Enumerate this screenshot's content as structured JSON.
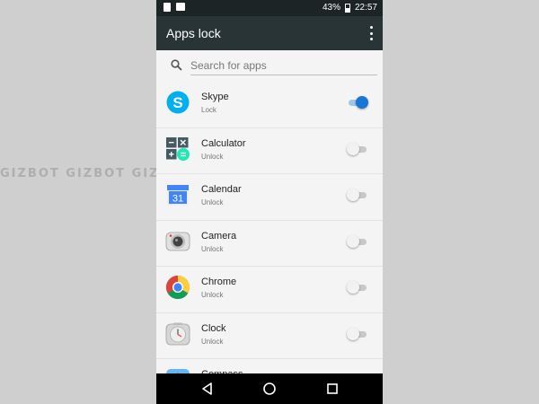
{
  "status_bar": {
    "battery": "43%",
    "time": "22:57"
  },
  "toolbar": {
    "title": "Apps lock"
  },
  "search": {
    "placeholder": "Search for apps"
  },
  "apps": [
    {
      "name": "Skype",
      "status": "Lock",
      "locked": true,
      "icon": "skype-icon"
    },
    {
      "name": "Calculator",
      "status": "Unlock",
      "locked": false,
      "icon": "calculator-icon"
    },
    {
      "name": "Calendar",
      "status": "Unlock",
      "locked": false,
      "icon": "calendar-icon",
      "icon_text": "31"
    },
    {
      "name": "Camera",
      "status": "Unlock",
      "locked": false,
      "icon": "camera-icon"
    },
    {
      "name": "Chrome",
      "status": "Unlock",
      "locked": false,
      "icon": "chrome-icon"
    },
    {
      "name": "Clock",
      "status": "Unlock",
      "locked": false,
      "icon": "clock-icon"
    },
    {
      "name": "Compass",
      "status": "",
      "locked": false,
      "icon": "compass-icon"
    }
  ],
  "watermark": "GIZBOT GIZBOT GIZBOT GIZBOT GIZBOT",
  "colors": {
    "toolbar": "#293436",
    "statusbar": "#1c2426",
    "accent": "#1976d2"
  }
}
